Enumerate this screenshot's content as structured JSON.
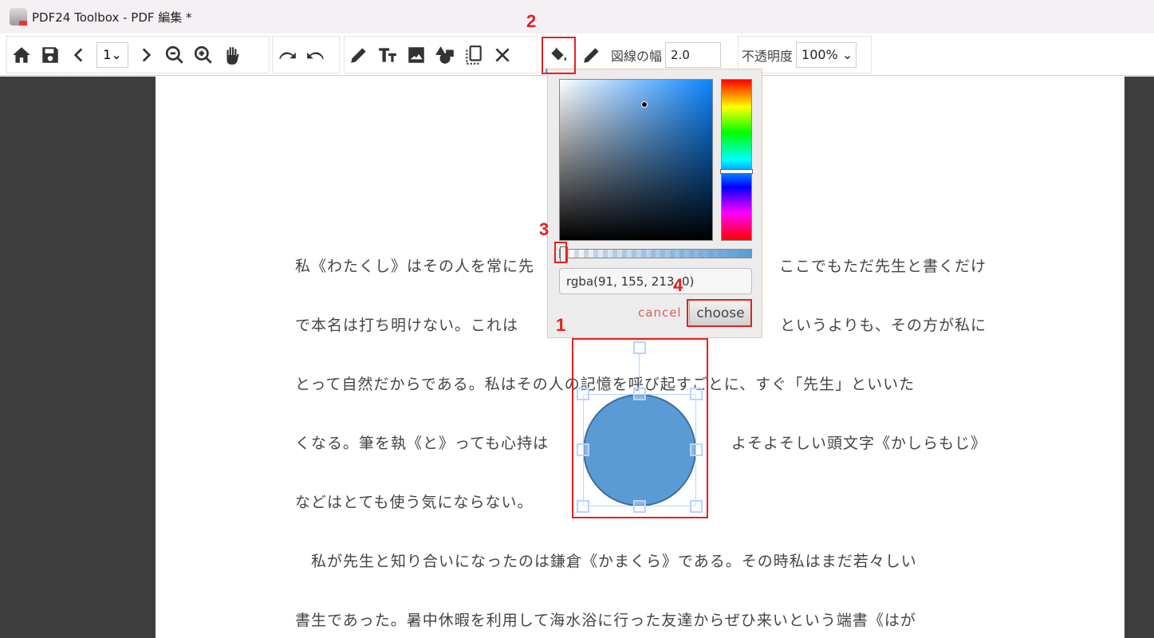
{
  "window": {
    "title": "PDF24 Toolbox - PDF 編集 *"
  },
  "toolbar": {
    "page_select": "1",
    "stroke_width_label": "図線の幅",
    "stroke_width_value": "2.0",
    "opacity_label": "不透明度",
    "opacity_value": "100%",
    "fill_color": "#5b9bd5",
    "stroke_color": "#3f6e9a",
    "icons": [
      "home-icon",
      "save-icon",
      "prev-page-icon",
      "next-page-icon",
      "zoom-out-icon",
      "zoom-in-icon",
      "hand-icon",
      "redo-icon",
      "undo-icon",
      "pen-icon",
      "text-icon",
      "image-icon",
      "shapes-icon",
      "select-icon",
      "close-icon",
      "fill-bucket-icon",
      "stroke-pen-icon"
    ]
  },
  "color_picker": {
    "value": "rgba(91, 155, 213, 0)",
    "alpha": 0,
    "cancel_label": "cancel",
    "choose_label": "choose"
  },
  "document": {
    "lines": [
      [
        "私《わたくし》はその人を常に先",
        "ここでもただ先生と書くだけ"
      ],
      [
        "で本名は打ち明けない。これは",
        "というよりも、その方が私に"
      ],
      [
        "とって自然だからである。私はその人の記憶を呼び起すごとに、すぐ「先生」といいた",
        ""
      ],
      [
        "くなる。筆を執《と》っても心持は",
        "よそよそしい頭文字《かしらもじ》"
      ],
      [
        "などはとても使う気にならない。",
        ""
      ],
      [
        "　私が先生と知り合いになったのは鎌倉《かまくら》である。その時私はまだ若々しい",
        ""
      ],
      [
        "書生であった。暑中休暇を利用して海水浴に行った友達からぜひ来いという端書《はが",
        ""
      ]
    ]
  },
  "annotations": [
    "1",
    "2",
    "3",
    "4"
  ]
}
